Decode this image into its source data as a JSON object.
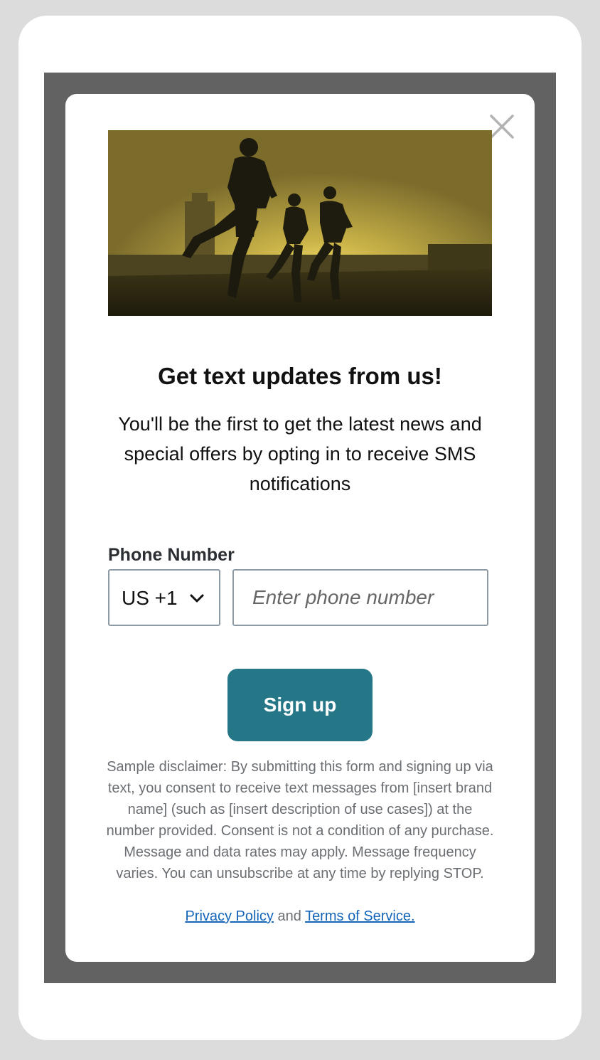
{
  "modal": {
    "close_icon": "close-icon",
    "hero_image": "runners-silhouette-sunset",
    "title": "Get text updates from us!",
    "subtitle": "You'll be the first to get the latest news and special offers by opting in to receive SMS notifications",
    "phone_label": "Phone Number",
    "country_code": "US +1",
    "country_icon": "chevron-down-icon",
    "phone_placeholder": "Enter phone number",
    "signup_label": "Sign up",
    "disclaimer": "Sample disclaimer: By submitting this form and signing up via text, you consent to receive text messages from [insert brand name] (such as [insert description of use cases]) at the number provided. Consent is not a condition of any purchase. Message and data rates may apply. Message frequency varies. You can unsubscribe at any time by replying STOP.",
    "privacy_link": "Privacy Policy",
    "links_joiner": "and",
    "terms_link": "Terms of Service."
  },
  "colors": {
    "overlay": "#626262",
    "button": "#257686",
    "link": "#1565b8",
    "hero_tint": "#c9b54a"
  }
}
